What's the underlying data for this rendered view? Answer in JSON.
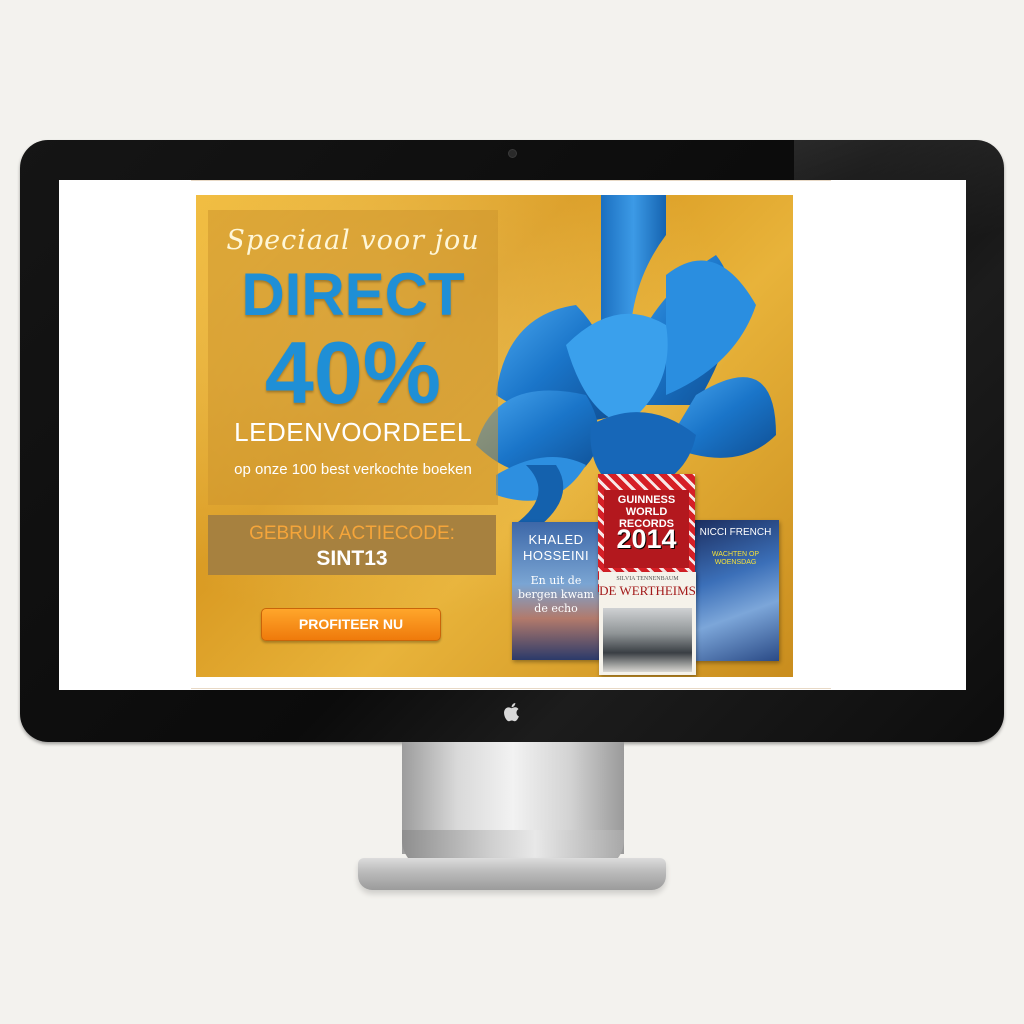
{
  "banner": {
    "tagline": "Speciaal voor jou",
    "headline": "DIRECT",
    "discount": "40%",
    "benefit": "LEDENVOORDEEL",
    "subline": "op onze 100 best verkochte boeken",
    "code_label": "GEBRUIK ACTIECODE:",
    "code_value": "SINT13",
    "cta_label": "PROFITEER NU"
  },
  "books": {
    "hosseini": {
      "author": "KHALED HOSSEINI",
      "title": "En uit de bergen kwam de echo"
    },
    "guinness": {
      "line1": "GUINNESS WORLD RECORDS",
      "year": "2014"
    },
    "french": {
      "author": "NICCI FRENCH",
      "title": "WACHTEN OP WOENSDAG"
    },
    "wertheims": {
      "author": "SILVIA TENNENBAUM",
      "title": "DE WERTHEIMS"
    }
  },
  "colors": {
    "ribbon": "#1f7fd0",
    "accent_blue": "#1f8fd6",
    "cta_orange": "#f08a14",
    "gold": "#e0a52c"
  }
}
